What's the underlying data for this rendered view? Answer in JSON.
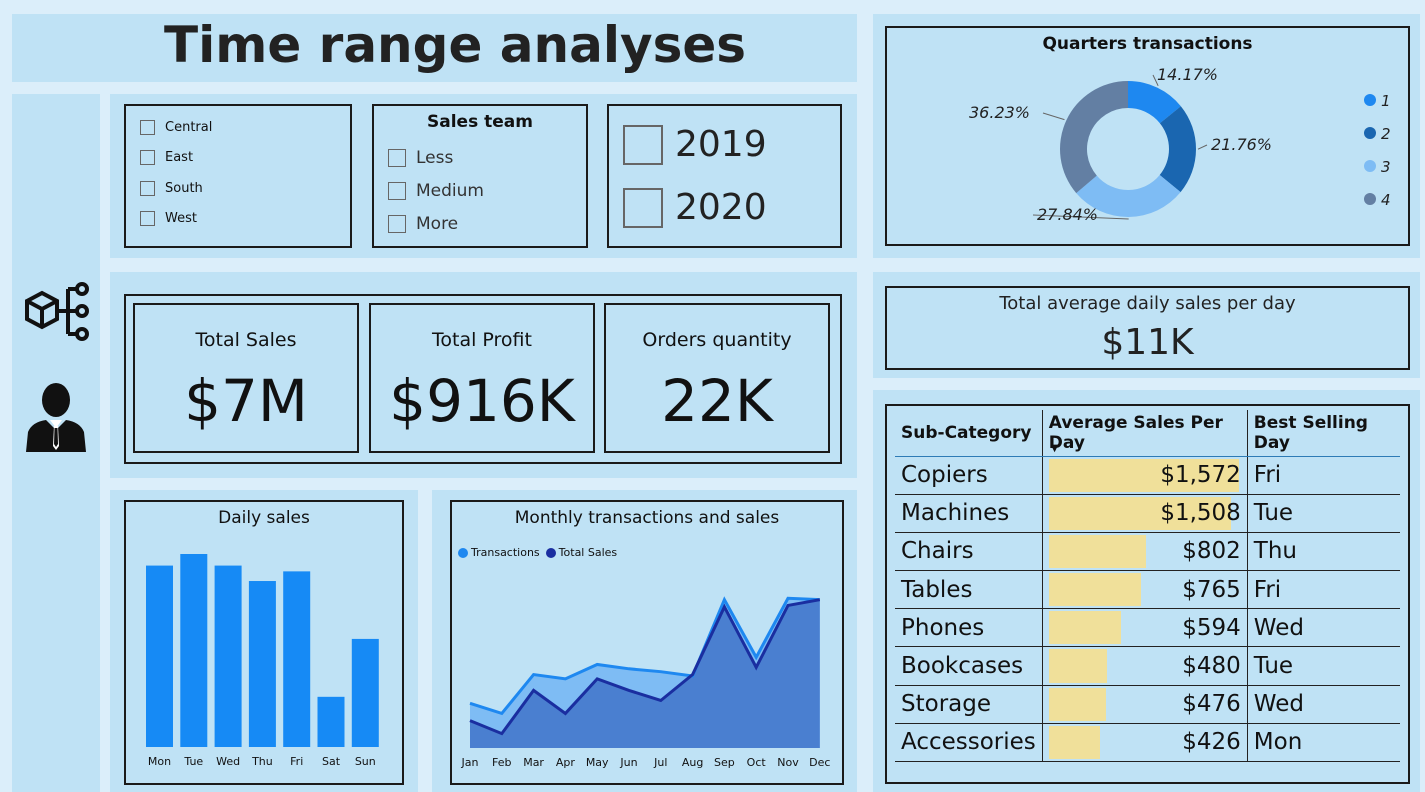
{
  "page_title": "Time range analyses",
  "region_filter": {
    "items": [
      "Central",
      "East",
      "South",
      "West"
    ]
  },
  "sales_team_filter": {
    "title": "Sales team",
    "items": [
      "Less",
      "Medium",
      "More"
    ]
  },
  "year_filter": {
    "items": [
      "2019",
      "2020"
    ]
  },
  "kpis": [
    {
      "label": "Total Sales",
      "value": "$7M"
    },
    {
      "label": "Total Profit",
      "value": "$916K"
    },
    {
      "label": "Orders quantity",
      "value": "22K"
    }
  ],
  "avg_daily": {
    "label": "Total average daily sales per day",
    "value": "$11K"
  },
  "quarters": {
    "title": "Quarters transactions",
    "legend": [
      "1",
      "2",
      "3",
      "4"
    ],
    "colors": [
      "#1e88f0",
      "#1a66b0",
      "#7ebcf4",
      "#637fa3"
    ]
  },
  "daily_sales": {
    "title": "Daily sales"
  },
  "monthly": {
    "title": "Monthly transactions and sales",
    "legend": [
      "Transactions",
      "Total Sales"
    ]
  },
  "subcategory_table": {
    "headers": [
      "Sub-Category",
      "Average Sales Per Day",
      "Best Selling Day"
    ],
    "rows": [
      {
        "name": "Copiers",
        "value": "$1,572",
        "amount": 1572,
        "day": "Fri"
      },
      {
        "name": "Machines",
        "value": "$1,508",
        "amount": 1508,
        "day": "Tue"
      },
      {
        "name": "Chairs",
        "value": "$802",
        "amount": 802,
        "day": "Thu"
      },
      {
        "name": "Tables",
        "value": "$765",
        "amount": 765,
        "day": "Fri"
      },
      {
        "name": "Phones",
        "value": "$594",
        "amount": 594,
        "day": "Wed"
      },
      {
        "name": "Bookcases",
        "value": "$480",
        "amount": 480,
        "day": "Tue"
      },
      {
        "name": "Storage",
        "value": "$476",
        "amount": 476,
        "day": "Wed"
      },
      {
        "name": "Accessories",
        "value": "$426",
        "amount": 426,
        "day": "Mon"
      }
    ]
  },
  "chart_data": [
    {
      "type": "pie",
      "title": "Quarters transactions",
      "categories": [
        "1",
        "2",
        "3",
        "4"
      ],
      "values": [
        14.17,
        21.76,
        27.84,
        36.23
      ],
      "labels": [
        "14.17%",
        "21.76%",
        "27.84%",
        "36.23%"
      ],
      "donut": true,
      "legend": "right"
    },
    {
      "type": "bar",
      "title": "Daily sales",
      "categories": [
        "Mon",
        "Tue",
        "Wed",
        "Thu",
        "Fri",
        "Sat",
        "Sun"
      ],
      "values": [
        0.94,
        1.0,
        0.94,
        0.86,
        0.91,
        0.26,
        0.56
      ],
      "color": "#168af5"
    },
    {
      "type": "area",
      "title": "Monthly transactions and sales",
      "x": [
        "Jan",
        "Feb",
        "Mar",
        "Apr",
        "May",
        "Jun",
        "Jul",
        "Aug",
        "Sep",
        "Oct",
        "Nov",
        "Dec"
      ],
      "series": [
        {
          "name": "Transactions",
          "values": [
            0.31,
            0.24,
            0.51,
            0.48,
            0.58,
            0.55,
            0.53,
            0.5,
            1.03,
            0.63,
            1.04,
            1.03
          ],
          "color": "#1e88f0"
        },
        {
          "name": "Total Sales",
          "values": [
            0.19,
            0.1,
            0.4,
            0.24,
            0.48,
            0.4,
            0.33,
            0.51,
            0.98,
            0.56,
            0.99,
            1.03
          ],
          "color": "#1a2ea0"
        }
      ],
      "legend": "top-left"
    }
  ]
}
